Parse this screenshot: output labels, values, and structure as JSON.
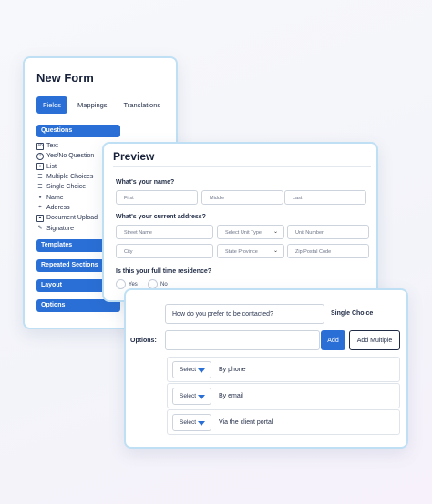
{
  "new_form": {
    "title": "New Form",
    "tabs": [
      "Fields",
      "Mappings",
      "Translations"
    ],
    "questions_label": "Questions",
    "questions": [
      {
        "label": "Text",
        "icon": "text-box-icon"
      },
      {
        "label": "Yes/No Question",
        "icon": "info-circle-icon"
      },
      {
        "label": "List",
        "icon": "list-box-icon"
      },
      {
        "label": "Multiple Choices",
        "icon": "checklist-icon"
      },
      {
        "label": "Single Choice",
        "icon": "list-icon"
      },
      {
        "label": "Name",
        "icon": "person-icon"
      },
      {
        "label": "Address",
        "icon": "location-pin-icon"
      },
      {
        "label": "Document Upload",
        "icon": "upload-icon"
      },
      {
        "label": "Signature",
        "icon": "signature-icon"
      }
    ],
    "sections": [
      "Templates",
      "Repeated Sections",
      "Layout",
      "Options"
    ]
  },
  "preview": {
    "title": "Preview",
    "name_question": "What's your name?",
    "name_fields": [
      "First",
      "Middle",
      "Last"
    ],
    "address_question": "What's your current address?",
    "address_row1": [
      "Street Name",
      "Select Unit Type",
      "Unit Number"
    ],
    "address_row2": [
      "City",
      "State Province",
      "Zip Postal Code"
    ],
    "residence_question": "Is this your full time residence?",
    "radio_yes": "Yes",
    "radio_no": "No"
  },
  "options_panel": {
    "question_value": "How do you prefer to be contacted?",
    "question_type": "Single Choice",
    "options_label": "Options:",
    "option_input_value": "",
    "add_button": "Add",
    "add_multiple_button": "Add Multiple",
    "select_label": "Select",
    "choices": [
      "By phone",
      "By email",
      "Via the client portal"
    ]
  },
  "colors": {
    "accent": "#2a6fd6",
    "card_border": "#bfe0f4",
    "text_dark": "#1f2a44"
  }
}
